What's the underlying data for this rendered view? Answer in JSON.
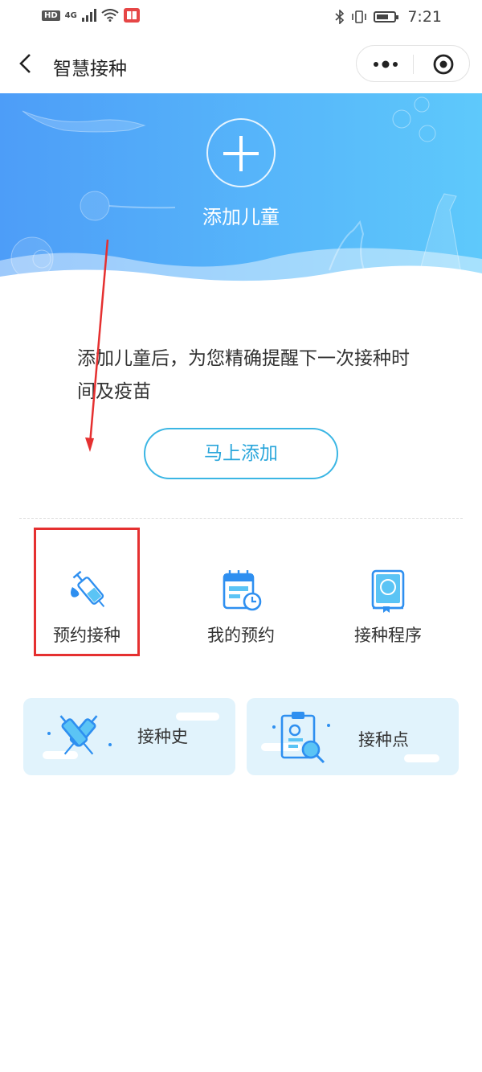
{
  "status_bar": {
    "network": "4G",
    "hd": "HD",
    "time": "7:21"
  },
  "nav": {
    "title": "智慧接种"
  },
  "banner": {
    "add_label": "添加儿童"
  },
  "prompt": {
    "text": "添加儿童后，为您精确提醒下一次接种时间及疫苗"
  },
  "add_button": {
    "label": "马上添加"
  },
  "features": [
    {
      "label": "预约接种",
      "icon": "vaccine-syringe-icon"
    },
    {
      "label": "我的预约",
      "icon": "calendar-clock-icon"
    },
    {
      "label": "接种程序",
      "icon": "book-icon"
    }
  ],
  "cards": [
    {
      "label": "接种史",
      "icon": "crossed-syringes-icon"
    },
    {
      "label": "接种点",
      "icon": "clipboard-search-icon"
    }
  ],
  "colors": {
    "accent": "#2aa6db",
    "banner_start": "#4d9df8",
    "banner_end": "#5ec9fb",
    "card_bg": "#e1f3fc",
    "highlight": "#e53030"
  }
}
